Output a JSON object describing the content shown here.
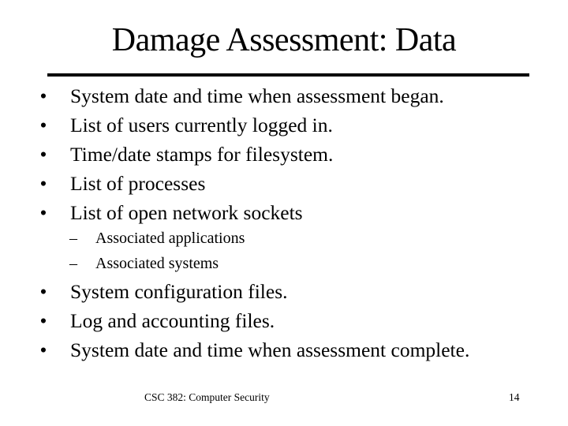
{
  "slide": {
    "title": "Damage Assessment: Data",
    "bullet_glyph": "•",
    "dash_glyph": "–",
    "bullets_group1": [
      "System date and time when assessment began.",
      "List of users currently logged in.",
      "Time/date stamps for filesystem.",
      "List of processes",
      "List of open network sockets"
    ],
    "sub_bullets": [
      "Associated applications",
      "Associated systems"
    ],
    "bullets_group2": [
      "System configuration files.",
      "Log and accounting files.",
      "System date and time when assessment complete."
    ],
    "footer": {
      "course": "CSC 382: Computer Security",
      "page_number": "14"
    }
  }
}
